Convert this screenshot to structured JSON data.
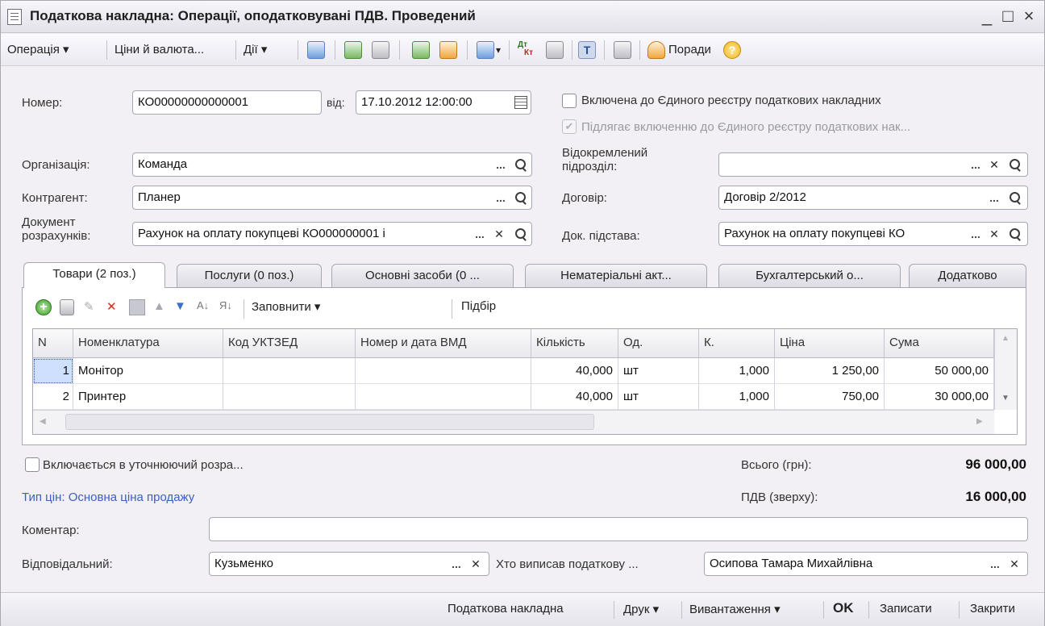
{
  "window": {
    "title": "Податкова накладна: Операції, оподатковувані ПДВ. Проведений",
    "minimize": "_",
    "maximize": "□",
    "close": "×"
  },
  "toolbar": {
    "operation": "Операція ▾",
    "prices": "Ціни й валюта...",
    "actions": "Дії ▾",
    "tips": "Поради",
    "help": "?",
    "dtkt_top": "Дт",
    "dtkt_bottom": "Кт",
    "icons": [
      "post-icon",
      "refresh-icon",
      "copy-icon",
      "export-icon",
      "import-icon",
      "goto-icon",
      "dtkt-icon",
      "report-icon",
      "text-toggle-icon",
      "structure-icon",
      "tips-icon",
      "help-icon"
    ]
  },
  "form": {
    "number_label": "Номер:",
    "number_value": "КО00000000000001",
    "from_label": "від:",
    "date_value": "17.10.2012 12:00:00",
    "included_label": "Включена до Єдиного реєстру податкових накладних",
    "subject_label": "Підлягає включенню до Єдиного реєстру податкових нак...",
    "subject_check": "✔",
    "org_label": "Організація:",
    "org_value": "Команда",
    "branch_label": "Відокремлений підрозділ:",
    "branch_value": "",
    "contractor_label": "Контрагент:",
    "contractor_value": "Планер",
    "contract_label": "Договір:",
    "contract_value": "Договір 2/2012",
    "settlement_label": "Документ розрахунків:",
    "settlement_value": "Рахунок на оплату покупцеві КО000000001 і",
    "basis_label": "Док. підстава:",
    "basis_value": "Рахунок на оплату покупцеві КО",
    "dots": "...",
    "x": "✕"
  },
  "tabs": [
    {
      "label": "Товари (2 поз.)",
      "active": true
    },
    {
      "label": "Послуги (0 поз.)",
      "active": false
    },
    {
      "label": "Основні засоби (0 ...",
      "active": false
    },
    {
      "label": "Нематеріальні акт...",
      "active": false
    },
    {
      "label": "Бухгалтерський о...",
      "active": false
    },
    {
      "label": "Додатково",
      "active": false
    }
  ],
  "panel_toolbar": {
    "fill": "Заповнити ▾",
    "select": "Підбір",
    "add": "+"
  },
  "table": {
    "columns": [
      "N",
      "Номенклатура",
      "Код УКТЗЕД",
      "Номер и дата ВМД",
      "Кількість",
      "Од.",
      "К.",
      "Ціна",
      "Сума"
    ],
    "rows": [
      [
        "1",
        "Монітор",
        "",
        "",
        "40,000",
        "шт",
        "1,000",
        "1 250,00",
        "50 000,00"
      ],
      [
        "2",
        "Принтер",
        "",
        "",
        "40,000",
        "шт",
        "1,000",
        "750,00",
        "30 000,00"
      ]
    ]
  },
  "totals": {
    "correction_label": "Включається в уточнюючий розра...",
    "price_type": "Тип цін: Основна ціна продажу",
    "total_label": "Всього (грн):",
    "total_value": "96 000,00",
    "vat_label": "ПДВ (зверху):",
    "vat_value": "16 000,00"
  },
  "comment": {
    "label": "Коментар:",
    "value": ""
  },
  "responsible": {
    "label": "Відповідальний:",
    "value": "Кузьменко",
    "issuer_label": "Хто виписав податкову ...",
    "issuer_value": "Осипова Тамара Михайлівна"
  },
  "footer": {
    "tax_invoice": "Податкова накладна",
    "print": "Друк ▾",
    "unload": "Вивантаження ▾",
    "ok": "OK",
    "save": "Записати",
    "close": "Закрити"
  },
  "colors": {
    "accent_link": "#3a5fc7",
    "selection": "#cfe0ff"
  }
}
